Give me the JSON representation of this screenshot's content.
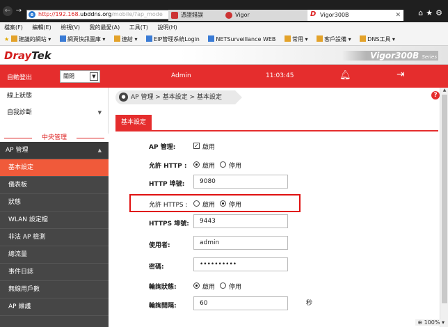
{
  "browser": {
    "address_red": "http://192.168.",
    "address_main": "ubddns.org",
    "address_tail": "/mobile/?ap_mode",
    "address_tools": "ρ ▾ ⊗ c",
    "tabs": [
      {
        "label": "憑證錯誤"
      },
      {
        "label": "Vigor"
      },
      {
        "label": "Vigor300B"
      }
    ],
    "menu": [
      "檔案(F)",
      "編輯(E)",
      "檢視(V)",
      "我的最愛(A)",
      "工具(T)",
      "說明(H)"
    ],
    "favorites": [
      "建議的網站 ▾",
      "網頁快訊圖庫 ▾",
      "連結 ▾",
      "EIP管理系統Login",
      "NETSurveillance WEB",
      "常用 ▾",
      "客戶設備 ▾",
      "DNS工具 ▾"
    ]
  },
  "header": {
    "logo_dray": "Dray",
    "logo_tek": "Tek",
    "model": "Vigor300B",
    "model_series": "Series",
    "auto_logout_label": "自動登出",
    "auto_logout_value": "關閉",
    "user": "Admin",
    "time": "11:03:45"
  },
  "sidebar": {
    "top_items": [
      "線上狀態",
      "自我診斷"
    ],
    "section_title": "中央管理",
    "parent": "AP 管理",
    "items": [
      "基本設定",
      "儀表板",
      "狀態",
      "WLAN 設定檔",
      "非法 AP 檢測",
      "總流量",
      "事件日誌",
      "無線用戶數",
      "AP 維護"
    ]
  },
  "content": {
    "breadcrumb": "AP 管理 > 基本設定 > 基本設定",
    "tab": "基本設定",
    "ap_mgmt_label": "AP 管理:",
    "ap_mgmt_option": "啟用",
    "http_label": "允許 HTTP :",
    "http_enable": "啟用",
    "http_disable": "停用",
    "http_port_label": "HTTP 埠號:",
    "http_port": "9080",
    "https_label": "允許 HTTPS :",
    "https_enable": "啟用",
    "https_disable": "停用",
    "https_port_label": "HTTPS 埠號:",
    "https_port": "9443",
    "user_label": "使用者:",
    "user_value": "admin",
    "password_label": "密碼:",
    "password_value": "••••••••••",
    "poll_status_label": "輪詢狀態:",
    "poll_enable": "啟用",
    "poll_disable": "停用",
    "poll_interval_label": "輪詢間隔:",
    "poll_interval": "60",
    "poll_unit": "秒"
  },
  "status": {
    "zoom": "100%"
  }
}
